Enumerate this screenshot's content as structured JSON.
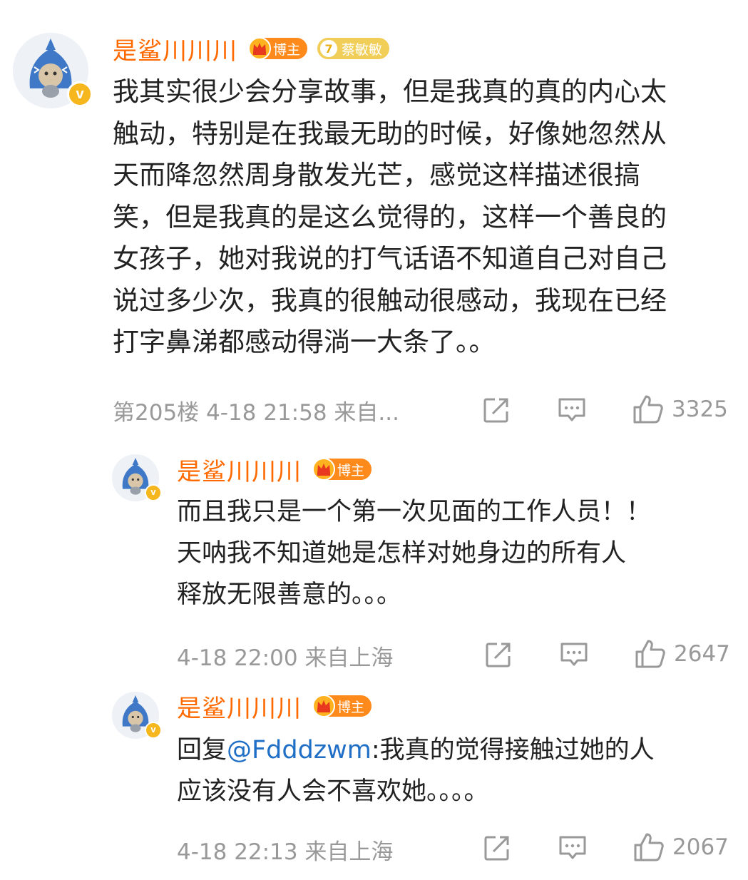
{
  "comments": [
    {
      "username": "是鲨川川川",
      "badges": {
        "host": "博主",
        "fan_level": "7",
        "fan_name": "蔡敏敏"
      },
      "text": "我其实很少会分享故事，但是我真的真的内心太\n触动，特别是在我最无助的时候，好像她忽然从\n天而降忽然周身散发光芒，感觉这样描述很搞\n笑，但是我真的是这么觉得的，这样一个善良的\n女孩子，她对我说的打气话语不知道自己对自己\n说过多少次，我真的很触动很感动，我现在已经\n打字鼻涕都感动得淌一大条了。。",
      "meta": "第205楼  4-18 21:58  来自...",
      "likes": "3325"
    },
    {
      "username": "是鲨川川川",
      "badges": {
        "host": "博主"
      },
      "text": "而且我只是一个第一次见面的工作人员！！\n天呐我不知道她是怎样对她身边的所有人\n释放无限善意的。。。",
      "meta": "4-18 22:00  来自上海",
      "likes": "2647"
    },
    {
      "username": "是鲨川川川",
      "badges": {
        "host": "博主"
      },
      "reply_prefix": "回复",
      "mention": "@Fdddzwm",
      "text_after_mention": ":我真的觉得接触过她的人\n应该没有人会不喜欢她。。。。",
      "meta": "4-18 22:13  来自上海",
      "likes": "2067"
    }
  ],
  "icons": {
    "share": "share-icon",
    "comment": "comment-icon",
    "like": "thumbs-up-icon",
    "verified": "verified-v-icon",
    "crown": "crown-icon"
  },
  "verified_mark": "v",
  "colors": {
    "username": "#ff6a00",
    "mention": "#1f6fc6",
    "meta": "#999999"
  }
}
